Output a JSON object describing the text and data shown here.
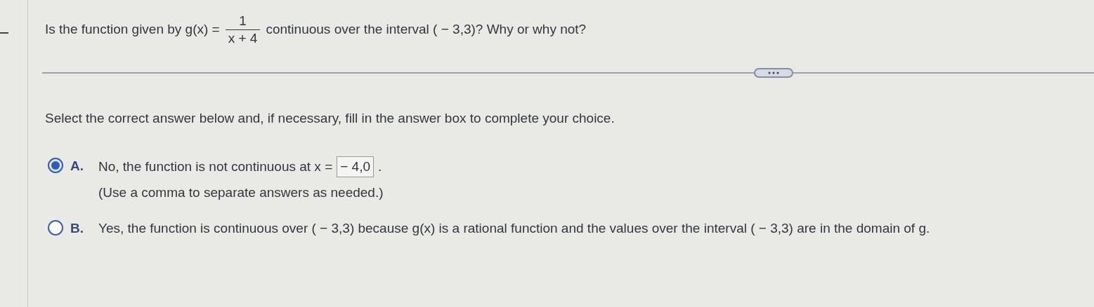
{
  "question": {
    "before": "Is the function given by g(x) =",
    "numerator": "1",
    "denominator": "x + 4",
    "after": "continuous over the interval ( − 3,3)? Why or why not?"
  },
  "instruction": "Select the correct answer below and, if necessary, fill in the answer box to complete your choice.",
  "options": [
    {
      "label": "A.",
      "selected": true,
      "kind": "answer",
      "text": "No, the function is not continuous at x =",
      "answer": "− 4,0",
      "after": ".",
      "hint": "(Use a comma to separate answers as needed.)"
    },
    {
      "label": "B.",
      "selected": false,
      "kind": "plain",
      "text": "Yes, the function is continuous over ( − 3,3) because g(x) is a rational function and the values over the interval ( − 3,3) are in the domain of g."
    }
  ]
}
